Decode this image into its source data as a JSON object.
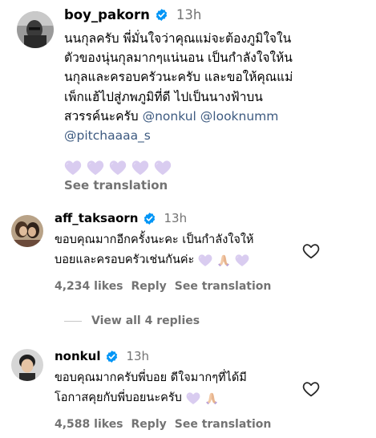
{
  "main_comment": {
    "username": "boy_pakorn",
    "time": "13h",
    "text_lines": [
      "นนกุลครับ พี่มั่นใจว่าคุณแม่จะต้องภูมิใจใน",
      "ตัวของนุ่นกุลมากๆแน่นอน เป็นกำลังใจให้น",
      "นกุลและครอบครัวนะครับ และขอให้คุณแม่",
      "เพ็กแฮ้ไปสู่ภพภูมิที่ดี ไปเป็นนางฟ้าบน",
      "สวรรค์นะครับ"
    ],
    "mentions": [
      "@nonkul",
      "@looknumm",
      "@pitchaaaa_s"
    ],
    "hearts": [
      "purple-heart",
      "purple-heart",
      "purple-heart",
      "purple-heart",
      "purple-heart"
    ],
    "see_translation": "See translation"
  },
  "replies": [
    {
      "username": "aff_taksaorn",
      "time": "13h",
      "lines": [
        "ขอบคุณมากอีกครั้งนะคะ เป็นกำลังใจให้",
        "บอยและครอบครัวเช่นกันค่ะ"
      ],
      "emojis": [
        "purple-heart",
        "praying-hands",
        "purple-heart"
      ],
      "likes": "4,234 likes",
      "reply_label": "Reply",
      "see_translation": "See translation"
    },
    {
      "username": "nonkul",
      "time": "13h",
      "lines": [
        "ขอบคุณมากครับพี่บอย ดีใจมากๆที่ได้มี",
        "โอกาสคุยกับพี่บอยนะครับ"
      ],
      "emojis": [
        "purple-heart",
        "praying-hands"
      ],
      "likes": "4,588 likes",
      "reply_label": "Reply",
      "see_translation": "See translation"
    }
  ],
  "view_replies": "View all 4 replies",
  "colors": {
    "verified": "#0095f6",
    "secondary_text": "#737373",
    "mention": "#3d5a80",
    "heart_emoji": "#d9ccf0"
  },
  "icons": {
    "verified": "verified-badge-icon",
    "like": "heart-outline-icon"
  }
}
